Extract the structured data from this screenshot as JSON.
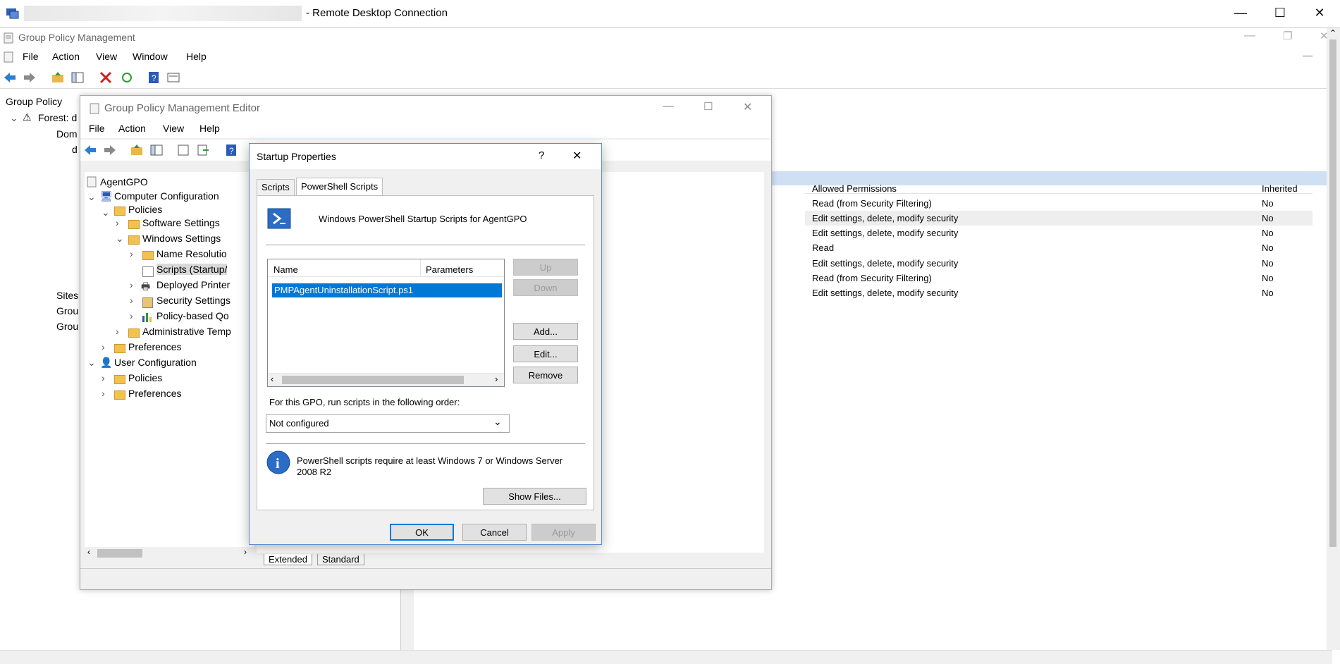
{
  "rdp": {
    "title": "- Remote Desktop Connection",
    "minimize": "—",
    "maximize": "☐",
    "close": "✕"
  },
  "gpm": {
    "title": "Group Policy Management",
    "menu": [
      "File",
      "Action",
      "View",
      "Window",
      "Help"
    ],
    "tree": {
      "root": "Group Policy",
      "forest": "Forest: d",
      "domains": "Dom",
      "d": "d",
      "sites": "Sites",
      "grou1": "Grou",
      "grou2": "Grou"
    }
  },
  "permissions": {
    "header_allowed": "Allowed Permissions",
    "header_inherited": "Inherited",
    "rows": [
      {
        "allowed": "Read (from Security Filtering)",
        "inherited": "No"
      },
      {
        "allowed": "Edit settings, delete, modify security",
        "inherited": "No"
      },
      {
        "allowed": "Edit settings, delete, modify security",
        "inherited": "No"
      },
      {
        "allowed": "Read",
        "inherited": "No"
      },
      {
        "allowed": "Edit settings, delete, modify security",
        "inherited": "No"
      },
      {
        "allowed": "Read (from Security Filtering)",
        "inherited": "No"
      },
      {
        "allowed": "Edit settings, delete, modify security",
        "inherited": "No"
      }
    ]
  },
  "editor": {
    "title": "Group Policy Management Editor",
    "menu": [
      "File",
      "Action",
      "View",
      "Help"
    ],
    "tree": {
      "root": "AgentGPO",
      "computer_config": "Computer Configuration",
      "policies": "Policies",
      "software_settings": "Software Settings",
      "windows_settings": "Windows Settings",
      "name_resolution": "Name Resolutio",
      "scripts": "Scripts (Startup/",
      "deployed_printers": "Deployed Printer",
      "security_settings": "Security Settings",
      "policy_qos": "Policy-based Qo",
      "admin_templates": "Administrative Temp",
      "preferences": "Preferences",
      "user_config": "User Configuration",
      "user_policies": "Policies",
      "user_preferences": "Preferences"
    },
    "bottom_tabs": [
      "Extended",
      "Standard"
    ]
  },
  "dialog": {
    "title": "Startup Properties",
    "help": "?",
    "close": "✕",
    "tabs": [
      "Scripts",
      "PowerShell Scripts"
    ],
    "heading": "Windows PowerShell Startup Scripts for AgentGPO",
    "columns": [
      "Name",
      "Parameters"
    ],
    "scripts": [
      "PMPAgentUninstallationScript.ps1"
    ],
    "buttons": {
      "up": "Up",
      "down": "Down",
      "add": "Add...",
      "edit": "Edit...",
      "remove": "Remove",
      "show_files": "Show Files...",
      "ok": "OK",
      "cancel": "Cancel",
      "apply": "Apply"
    },
    "order_label": "For this GPO, run scripts in the following order:",
    "order_value": "Not configured",
    "info": "PowerShell scripts require at least Windows 7 or Windows Server 2008 R2"
  }
}
